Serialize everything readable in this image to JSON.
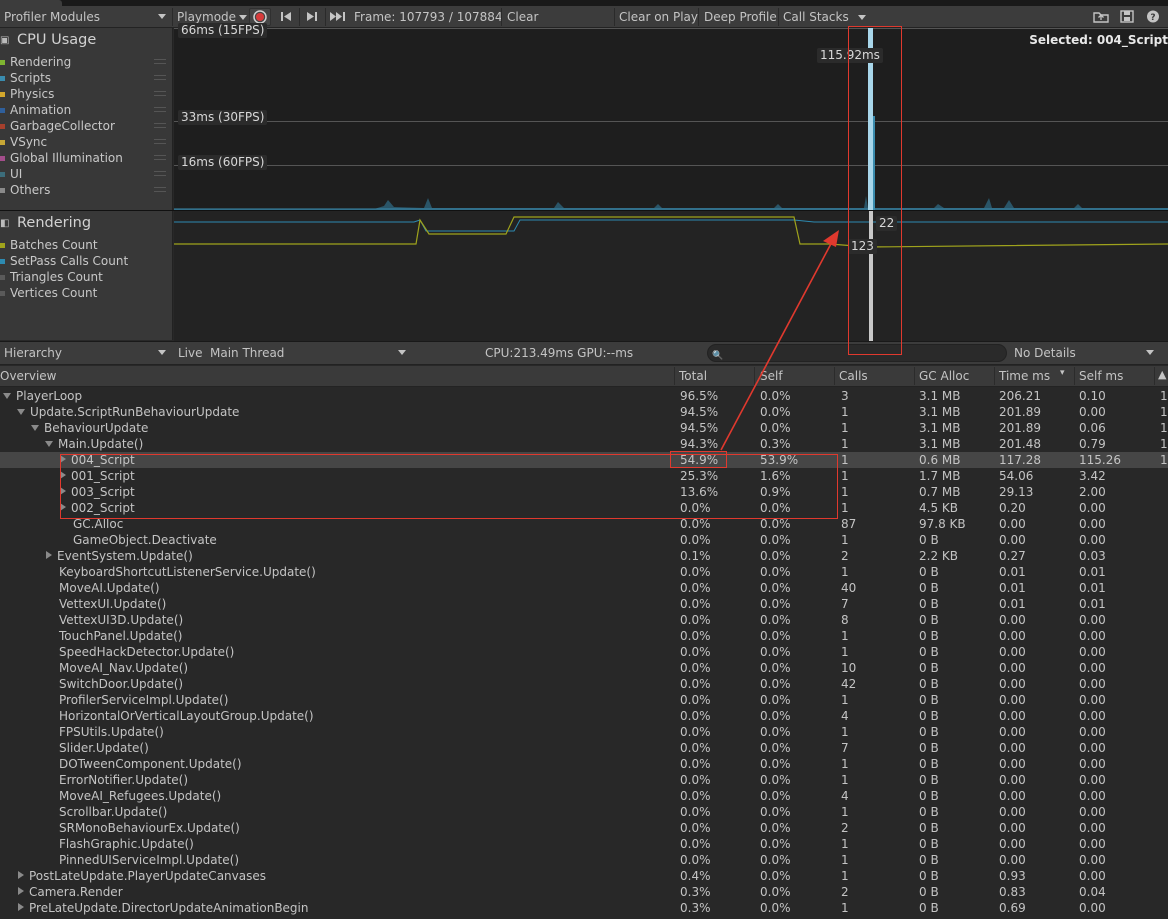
{
  "window": {
    "tab_title": "Profiler"
  },
  "toolbar": {
    "modules_label": "Profiler Modules",
    "playmode_label": "Playmode",
    "frame_label": "Frame: 107793 / 107884",
    "clear_label": "Clear",
    "clear_on_play_label": "Clear on Play",
    "deep_profile_label": "Deep Profile",
    "call_stacks_label": "Call Stacks",
    "icons": [
      "record-icon",
      "prev-frame-icon",
      "next-frame-icon",
      "last-frame-icon",
      "load-icon",
      "save-icon",
      "help-icon"
    ]
  },
  "cpu_module": {
    "title": "CPU Usage",
    "legend": [
      "Rendering",
      "Scripts",
      "Physics",
      "Animation",
      "GarbageCollector",
      "VSync",
      "Global Illumination",
      "UI",
      "Others"
    ],
    "legend_colors": [
      "#7fb531",
      "#3a8cae",
      "#d3a72c",
      "#2f5f9b",
      "#a6402d",
      "#c7a736",
      "#a34e8b",
      "#3c6d7b",
      "#8a8a8a"
    ],
    "line_labels": [
      "66ms (15FPS)",
      "33ms (30FPS)",
      "16ms (60FPS)"
    ],
    "cursor_label": "115.92ms",
    "selected_label": "Selected: 004_Script"
  },
  "render_module": {
    "title": "Rendering",
    "legend": [
      "Batches Count",
      "SetPass Calls Count",
      "Triangles Count",
      "Vertices Count"
    ],
    "legend_colors": [
      "#9fa31c",
      "#2d8ab0",
      "#5a5a5a",
      "#5a5a5a"
    ],
    "value_setpass": "22",
    "value_batches": "123"
  },
  "hierarchy_bar": {
    "view_label": "Hierarchy",
    "live_label": "Live",
    "thread_label": "Main Thread",
    "stats_label": "CPU:213.49ms   GPU:--ms",
    "search_placeholder": "",
    "details_label": "No Details"
  },
  "columns": [
    "Overview",
    "Total",
    "Self",
    "Calls",
    "GC Alloc",
    "Time ms",
    "Self ms"
  ],
  "rows": [
    {
      "name": "PlayerLoop",
      "indent": 0,
      "expander": "open",
      "total": "96.5%",
      "self": "0.0%",
      "calls": "3",
      "gc": "3.1 MB",
      "time": "206.21",
      "selfms": "0.10",
      "extra": "1"
    },
    {
      "name": "Update.ScriptRunBehaviourUpdate",
      "indent": 1,
      "expander": "open",
      "total": "94.5%",
      "self": "0.0%",
      "calls": "1",
      "gc": "3.1 MB",
      "time": "201.89",
      "selfms": "0.00",
      "extra": "1"
    },
    {
      "name": "BehaviourUpdate",
      "indent": 2,
      "expander": "open",
      "total": "94.5%",
      "self": "0.0%",
      "calls": "1",
      "gc": "3.1 MB",
      "time": "201.89",
      "selfms": "0.06",
      "extra": "1"
    },
    {
      "name": "Main.Update()",
      "indent": 3,
      "expander": "open",
      "total": "94.3%",
      "self": "0.3%",
      "calls": "1",
      "gc": "3.1 MB",
      "time": "201.48",
      "selfms": "0.79",
      "extra": "1"
    },
    {
      "name": "004_Script",
      "indent": 4,
      "expander": "closed",
      "total": "54.9%",
      "self": "53.9%",
      "calls": "1",
      "gc": "0.6 MB",
      "time": "117.28",
      "selfms": "115.26",
      "extra": "1",
      "selected": true
    },
    {
      "name": "001_Script",
      "indent": 4,
      "expander": "closed",
      "total": "25.3%",
      "self": "1.6%",
      "calls": "1",
      "gc": "1.7 MB",
      "time": "54.06",
      "selfms": "3.42",
      "extra": ""
    },
    {
      "name": "003_Script",
      "indent": 4,
      "expander": "closed",
      "total": "13.6%",
      "self": "0.9%",
      "calls": "1",
      "gc": "0.7 MB",
      "time": "29.13",
      "selfms": "2.00",
      "extra": ""
    },
    {
      "name": "002_Script",
      "indent": 4,
      "expander": "closed",
      "total": "0.0%",
      "self": "0.0%",
      "calls": "1",
      "gc": "4.5 KB",
      "time": "0.20",
      "selfms": "0.00",
      "extra": ""
    },
    {
      "name": "GC.Alloc",
      "indent": 4,
      "expander": "none",
      "total": "0.0%",
      "self": "0.0%",
      "calls": "87",
      "gc": "97.8 KB",
      "time": "0.00",
      "selfms": "0.00",
      "extra": ""
    },
    {
      "name": "GameObject.Deactivate",
      "indent": 4,
      "expander": "none",
      "total": "0.0%",
      "self": "0.0%",
      "calls": "1",
      "gc": "0 B",
      "time": "0.00",
      "selfms": "0.00",
      "extra": ""
    },
    {
      "name": "EventSystem.Update()",
      "indent": 3,
      "expander": "closed",
      "total": "0.1%",
      "self": "0.0%",
      "calls": "2",
      "gc": "2.2 KB",
      "time": "0.27",
      "selfms": "0.03",
      "extra": ""
    },
    {
      "name": "KeyboardShortcutListenerService.Update()",
      "indent": 3,
      "expander": "none",
      "total": "0.0%",
      "self": "0.0%",
      "calls": "1",
      "gc": "0 B",
      "time": "0.01",
      "selfms": "0.01",
      "extra": ""
    },
    {
      "name": "MoveAI.Update()",
      "indent": 3,
      "expander": "none",
      "total": "0.0%",
      "self": "0.0%",
      "calls": "40",
      "gc": "0 B",
      "time": "0.01",
      "selfms": "0.01",
      "extra": ""
    },
    {
      "name": "VettexUI.Update()",
      "indent": 3,
      "expander": "none",
      "total": "0.0%",
      "self": "0.0%",
      "calls": "7",
      "gc": "0 B",
      "time": "0.01",
      "selfms": "0.01",
      "extra": ""
    },
    {
      "name": "VettexUI3D.Update()",
      "indent": 3,
      "expander": "none",
      "total": "0.0%",
      "self": "0.0%",
      "calls": "8",
      "gc": "0 B",
      "time": "0.00",
      "selfms": "0.00",
      "extra": ""
    },
    {
      "name": "TouchPanel.Update()",
      "indent": 3,
      "expander": "none",
      "total": "0.0%",
      "self": "0.0%",
      "calls": "1",
      "gc": "0 B",
      "time": "0.00",
      "selfms": "0.00",
      "extra": ""
    },
    {
      "name": "SpeedHackDetector.Update()",
      "indent": 3,
      "expander": "none",
      "total": "0.0%",
      "self": "0.0%",
      "calls": "1",
      "gc": "0 B",
      "time": "0.00",
      "selfms": "0.00",
      "extra": ""
    },
    {
      "name": "MoveAI_Nav.Update()",
      "indent": 3,
      "expander": "none",
      "total": "0.0%",
      "self": "0.0%",
      "calls": "10",
      "gc": "0 B",
      "time": "0.00",
      "selfms": "0.00",
      "extra": ""
    },
    {
      "name": "SwitchDoor.Update()",
      "indent": 3,
      "expander": "none",
      "total": "0.0%",
      "self": "0.0%",
      "calls": "42",
      "gc": "0 B",
      "time": "0.00",
      "selfms": "0.00",
      "extra": ""
    },
    {
      "name": "ProfilerServiceImpl.Update()",
      "indent": 3,
      "expander": "none",
      "total": "0.0%",
      "self": "0.0%",
      "calls": "1",
      "gc": "0 B",
      "time": "0.00",
      "selfms": "0.00",
      "extra": ""
    },
    {
      "name": "HorizontalOrVerticalLayoutGroup.Update()",
      "indent": 3,
      "expander": "none",
      "total": "0.0%",
      "self": "0.0%",
      "calls": "4",
      "gc": "0 B",
      "time": "0.00",
      "selfms": "0.00",
      "extra": ""
    },
    {
      "name": "FPSUtils.Update()",
      "indent": 3,
      "expander": "none",
      "total": "0.0%",
      "self": "0.0%",
      "calls": "1",
      "gc": "0 B",
      "time": "0.00",
      "selfms": "0.00",
      "extra": ""
    },
    {
      "name": "Slider.Update()",
      "indent": 3,
      "expander": "none",
      "total": "0.0%",
      "self": "0.0%",
      "calls": "7",
      "gc": "0 B",
      "time": "0.00",
      "selfms": "0.00",
      "extra": ""
    },
    {
      "name": "DOTweenComponent.Update()",
      "indent": 3,
      "expander": "none",
      "total": "0.0%",
      "self": "0.0%",
      "calls": "1",
      "gc": "0 B",
      "time": "0.00",
      "selfms": "0.00",
      "extra": ""
    },
    {
      "name": "ErrorNotifier.Update()",
      "indent": 3,
      "expander": "none",
      "total": "0.0%",
      "self": "0.0%",
      "calls": "1",
      "gc": "0 B",
      "time": "0.00",
      "selfms": "0.00",
      "extra": ""
    },
    {
      "name": "MoveAI_Refugees.Update()",
      "indent": 3,
      "expander": "none",
      "total": "0.0%",
      "self": "0.0%",
      "calls": "4",
      "gc": "0 B",
      "time": "0.00",
      "selfms": "0.00",
      "extra": ""
    },
    {
      "name": "Scrollbar.Update()",
      "indent": 3,
      "expander": "none",
      "total": "0.0%",
      "self": "0.0%",
      "calls": "1",
      "gc": "0 B",
      "time": "0.00",
      "selfms": "0.00",
      "extra": ""
    },
    {
      "name": "SRMonoBehaviourEx.Update()",
      "indent": 3,
      "expander": "none",
      "total": "0.0%",
      "self": "0.0%",
      "calls": "2",
      "gc": "0 B",
      "time": "0.00",
      "selfms": "0.00",
      "extra": ""
    },
    {
      "name": "FlashGraphic.Update()",
      "indent": 3,
      "expander": "none",
      "total": "0.0%",
      "self": "0.0%",
      "calls": "1",
      "gc": "0 B",
      "time": "0.00",
      "selfms": "0.00",
      "extra": ""
    },
    {
      "name": "PinnedUIServiceImpl.Update()",
      "indent": 3,
      "expander": "none",
      "total": "0.0%",
      "self": "0.0%",
      "calls": "1",
      "gc": "0 B",
      "time": "0.00",
      "selfms": "0.00",
      "extra": ""
    },
    {
      "name": "PostLateUpdate.PlayerUpdateCanvases",
      "indent": 1,
      "expander": "closed",
      "total": "0.4%",
      "self": "0.0%",
      "calls": "1",
      "gc": "0 B",
      "time": "0.93",
      "selfms": "0.00",
      "extra": ""
    },
    {
      "name": "Camera.Render",
      "indent": 1,
      "expander": "closed",
      "total": "0.3%",
      "self": "0.0%",
      "calls": "2",
      "gc": "0 B",
      "time": "0.83",
      "selfms": "0.04",
      "extra": ""
    },
    {
      "name": "PreLateUpdate.DirectorUpdateAnimationBegin",
      "indent": 1,
      "expander": "closed",
      "total": "0.3%",
      "self": "0.0%",
      "calls": "1",
      "gc": "0 B",
      "time": "0.69",
      "selfms": "0.00",
      "extra": ""
    }
  ],
  "annotation": {
    "color": "#e0392e"
  }
}
